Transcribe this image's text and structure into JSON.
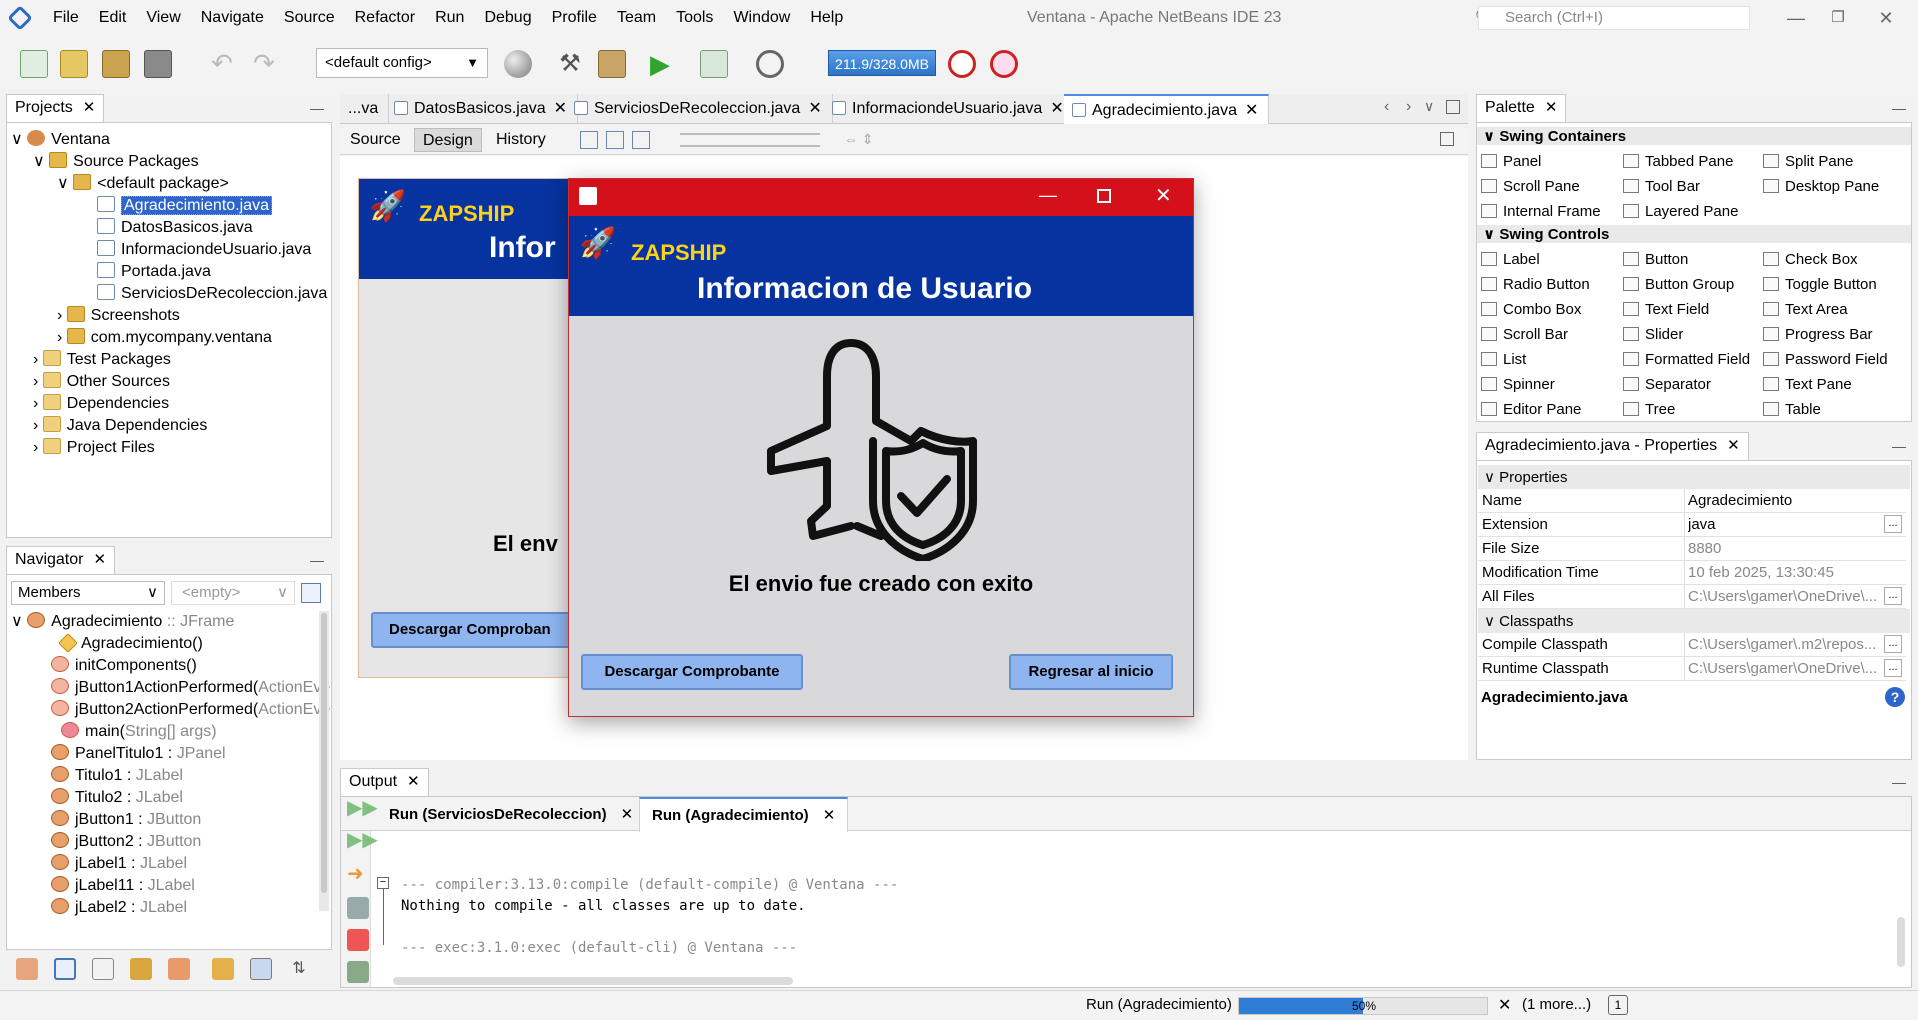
{
  "menu": [
    "File",
    "Edit",
    "View",
    "Navigate",
    "Source",
    "Refactor",
    "Run",
    "Debug",
    "Profile",
    "Team",
    "Tools",
    "Window",
    "Help"
  ],
  "window_title": "Ventana - Apache NetBeans IDE 23",
  "search_placeholder": "Search (Ctrl+I)",
  "toolbar": {
    "config": "<default config>",
    "memory": "211.9/328.0MB"
  },
  "projects": {
    "tab": "Projects",
    "items": [
      "Ventana",
      "Source Packages",
      "<default package>",
      "Agradecimiento.java",
      "DatosBasicos.java",
      "InformaciondeUsuario.java",
      "Portada.java",
      "ServiciosDeRecoleccion.java",
      "Screenshots",
      "com.mycompany.ventana",
      "Test Packages",
      "Other Sources",
      "Dependencies",
      "Java Dependencies",
      "Project Files"
    ]
  },
  "navigator": {
    "tab": "Navigator",
    "members": "Members",
    "filter": "<empty>",
    "items": [
      {
        "name": "Agradecimiento",
        "type": " :: JFrame"
      },
      {
        "name": "Agradecimiento()",
        "type": ""
      },
      {
        "name": "initComponents()",
        "type": ""
      },
      {
        "name": "jButton1ActionPerformed(",
        "type": "ActionEve"
      },
      {
        "name": "jButton2ActionPerformed(",
        "type": "ActionEve"
      },
      {
        "name": "main(",
        "type": "String[] args)"
      },
      {
        "name": "PanelTitulo1 : ",
        "type": "JPanel"
      },
      {
        "name": "Titulo1 : ",
        "type": "JLabel"
      },
      {
        "name": "Titulo2 : ",
        "type": "JLabel"
      },
      {
        "name": "jButton1 : ",
        "type": "JButton"
      },
      {
        "name": "jButton2 : ",
        "type": "JButton"
      },
      {
        "name": "jLabel1 : ",
        "type": "JLabel"
      },
      {
        "name": "jLabel11 : ",
        "type": "JLabel"
      },
      {
        "name": "jLabel2 : ",
        "type": "JLabel"
      }
    ]
  },
  "editor": {
    "tabs": [
      "...va",
      "DatosBasicos.java",
      "ServiciosDeRecoleccion.java",
      "InformaciondeUsuario.java",
      "Agradecimiento.java"
    ],
    "subtabs": [
      "Source",
      "Design",
      "History"
    ]
  },
  "form": {
    "brand": "ZAPSHIP",
    "title_partial": "Infor",
    "msg_partial": "El env",
    "button_partial": "Descargar Comproban"
  },
  "dialog": {
    "brand": "ZAPSHIP",
    "title": "Informacion de Usuario",
    "message": "El envio fue creado con exito",
    "btn_download": "Descargar Comprobante",
    "btn_back": "Regresar al inicio"
  },
  "palette": {
    "tab": "Palette",
    "containers_header": "Swing Containers",
    "containers": [
      "Panel",
      "Tabbed Pane",
      "Split Pane",
      "Scroll Pane",
      "Tool Bar",
      "Desktop Pane",
      "Internal Frame",
      "Layered Pane"
    ],
    "controls_header": "Swing Controls",
    "controls": [
      "Label",
      "Button",
      "Check Box",
      "Radio Button",
      "Button Group",
      "Toggle Button",
      "Combo Box",
      "Text Field",
      "Text Area",
      "Scroll Bar",
      "Slider",
      "Progress Bar",
      "List",
      "Formatted Field",
      "Password Field",
      "Spinner",
      "Separator",
      "Text Pane",
      "Editor Pane",
      "Tree",
      "Table"
    ]
  },
  "properties": {
    "tab": "Agradecimiento.java - Properties",
    "section1": "Properties",
    "rows1": [
      {
        "k": "Name",
        "v": "Agradecimiento"
      },
      {
        "k": "Extension",
        "v": "java"
      },
      {
        "k": "File Size",
        "v": "8880"
      },
      {
        "k": "Modification Time",
        "v": "10 feb 2025, 13:30:45"
      },
      {
        "k": "All Files",
        "v": "C:\\Users\\gamer\\OneDrive\\..."
      }
    ],
    "section2": "Classpaths",
    "rows2": [
      {
        "k": "Compile Classpath",
        "v": "C:\\Users\\gamer\\.m2\\repos..."
      },
      {
        "k": "Runtime Classpath",
        "v": "C:\\Users\\gamer\\OneDrive\\..."
      }
    ],
    "footer": "Agradecimiento.java"
  },
  "output": {
    "tab": "Output",
    "subtabs": [
      "Run (ServiciosDeRecoleccion)",
      "Run (Agradecimiento)"
    ],
    "lines": [
      "--- compiler:3.13.0:compile (default-compile) @ Ventana ---",
      "Nothing to compile - all classes are up to date.",
      "",
      "--- exec:3.1.0:exec (default-cli) @ Ventana ---"
    ]
  },
  "status": {
    "task": "Run (Agradecimiento)",
    "progress": 0.5,
    "progress_label": "50%",
    "more": "(1 more...)",
    "notif": "1"
  }
}
